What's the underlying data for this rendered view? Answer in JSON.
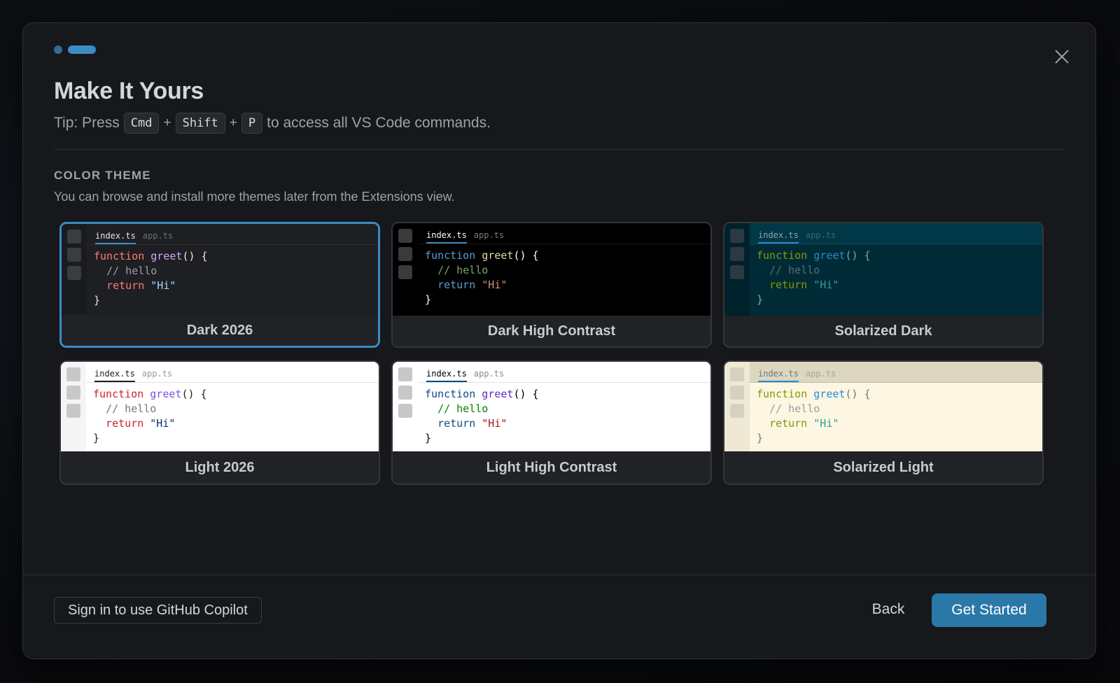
{
  "dialog": {
    "title": "Make It Yours",
    "tip": {
      "prefix": "Tip: Press",
      "keys": [
        "Cmd",
        "Shift",
        "P"
      ],
      "separator": "+",
      "suffix": "to access all VS Code commands."
    },
    "progress": {
      "total_steps": 2,
      "current_step": 2
    }
  },
  "color_theme": {
    "section_title": "COLOR THEME",
    "description": "You can browse and install more themes later from the Extensions view.",
    "selected": "Dark 2026",
    "preview_tabs": [
      "index.ts",
      "app.ts"
    ],
    "themes": [
      {
        "name": "Dark 2026",
        "colors": {
          "bg": "#1e1f22",
          "gutter": "#1a1b1e",
          "gutter_sq": "#3a3c40",
          "tabbar": "#1e1f22",
          "tab_active": "#e6e6e6",
          "tab_inactive": "#6b6e73",
          "underline": "#3a8cc4",
          "keyword": "#ff7b72",
          "func": "#d2a8ff",
          "comment": "#9aa0a6",
          "string": "#a5d6ff",
          "punct": "#e6e6e6"
        }
      },
      {
        "name": "Dark High Contrast",
        "colors": {
          "bg": "#000000",
          "gutter": "#000000",
          "gutter_sq": "#3a3a3a",
          "tabbar": "#000000",
          "tab_active": "#ffffff",
          "tab_inactive": "#7a7a7a",
          "underline": "#3a8cc4",
          "keyword": "#569cd6",
          "func": "#dcdcaa",
          "comment": "#7ca668",
          "string": "#ce9178",
          "punct": "#ffffff"
        }
      },
      {
        "name": "Solarized Dark",
        "colors": {
          "bg": "#002b36",
          "gutter": "#00212b",
          "gutter_sq": "#2a3a40",
          "tabbar": "#003847",
          "tab_active": "#93a1a1",
          "tab_inactive": "#3f6470",
          "underline": "#268bd2",
          "keyword": "#859900",
          "func": "#268bd2",
          "comment": "#586e75",
          "string": "#2aa198",
          "punct": "#93a1a1"
        }
      },
      {
        "name": "Light 2026",
        "colors": {
          "bg": "#ffffff",
          "gutter": "#f5f5f5",
          "gutter_sq": "#c8c8c8",
          "tabbar": "#ffffff",
          "tab_active": "#1f1f1f",
          "tab_inactive": "#9a9a9a",
          "underline": "#1f1f1f",
          "keyword": "#cf222e",
          "func": "#8250df",
          "comment": "#6e7781",
          "string": "#0a3069",
          "punct": "#1f1f1f"
        }
      },
      {
        "name": "Light High Contrast",
        "colors": {
          "bg": "#ffffff",
          "gutter": "#ffffff",
          "gutter_sq": "#c8c8c8",
          "tabbar": "#ffffff",
          "tab_active": "#000000",
          "tab_inactive": "#8a8a8a",
          "underline": "#0f4a85",
          "keyword": "#0f4a85",
          "func": "#5e2cbc",
          "comment": "#008000",
          "string": "#a31515",
          "punct": "#000000"
        }
      },
      {
        "name": "Solarized Light",
        "colors": {
          "bg": "#fdf6e3",
          "gutter": "#eee8d5",
          "gutter_sq": "#d6d0bf",
          "tabbar": "#ddd6c1",
          "tab_active": "#657b83",
          "tab_inactive": "#a8a395",
          "underline": "#268bd2",
          "keyword": "#859900",
          "func": "#268bd2",
          "comment": "#93a1a1",
          "string": "#2aa198",
          "punct": "#657b83"
        }
      }
    ],
    "code_sample": {
      "keyword": "function",
      "func_name": "greet",
      "signature": "() {",
      "comment": "// hello",
      "return_kw": "return",
      "return_val": "\"Hi\"",
      "close": "}"
    }
  },
  "footer": {
    "copilot_label": "Sign in to use GitHub Copilot",
    "back_label": "Back",
    "start_label": "Get Started"
  },
  "accent": {
    "primary": "#2a78a8",
    "selection_border": "#3a8cc4"
  }
}
